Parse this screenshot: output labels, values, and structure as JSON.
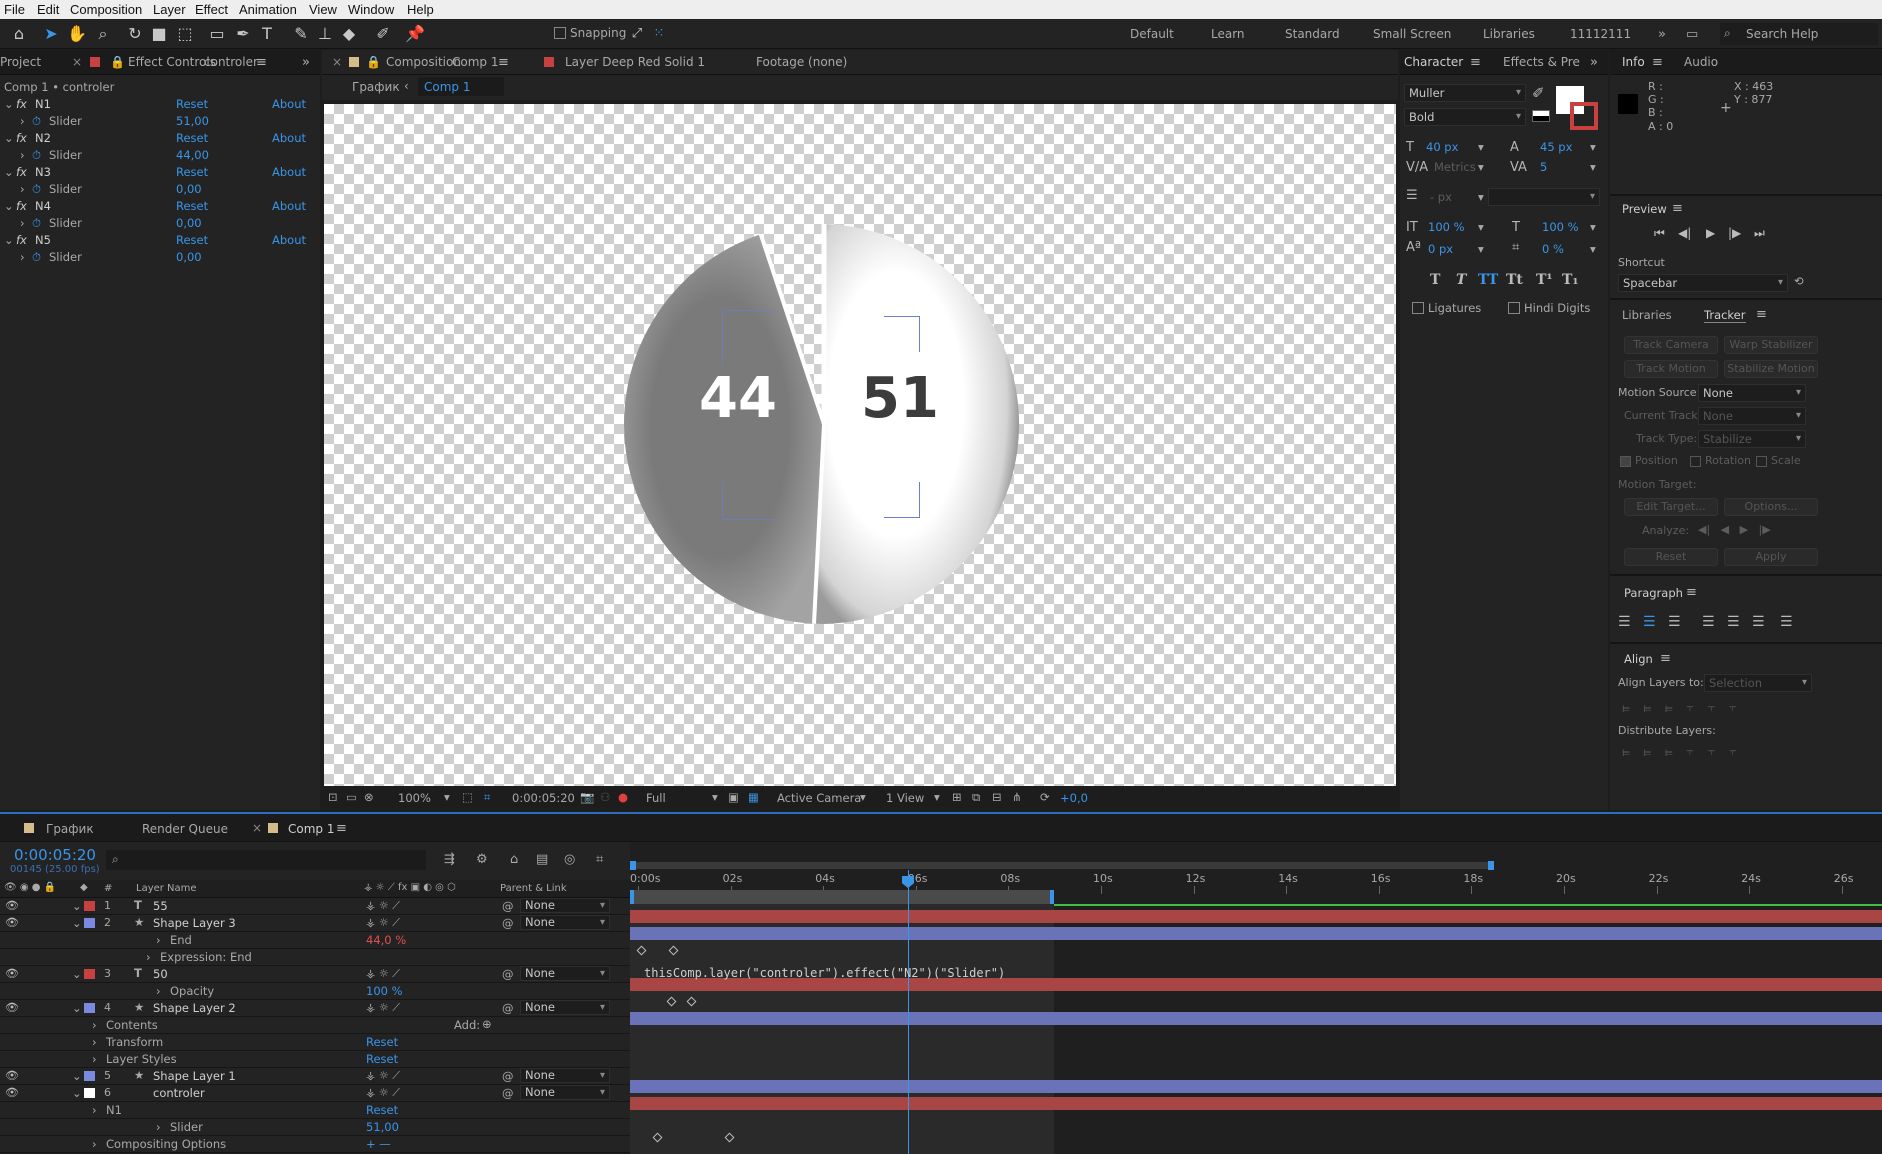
{
  "menu": [
    "File",
    "Edit",
    "Composition",
    "Layer",
    "Effect",
    "Animation",
    "View",
    "Window",
    "Help"
  ],
  "toolbar": {
    "snapping": "Snapping",
    "workspaces": [
      "Default",
      "Learn",
      "Standard",
      "Small Screen",
      "Libraries"
    ],
    "active_workspace": "11112111",
    "search": "Search Help"
  },
  "left_panel": {
    "tab_project": "Project",
    "tab_effect": "Effect Controls",
    "tab_effect_layer": "controler",
    "breadcrumb": "Comp 1 • controler",
    "effects": [
      {
        "name": "N1",
        "reset": "Reset",
        "about": "About",
        "param": "Slider",
        "value": "51,00"
      },
      {
        "name": "N2",
        "reset": "Reset",
        "about": "About",
        "param": "Slider",
        "value": "44,00"
      },
      {
        "name": "N3",
        "reset": "Reset",
        "about": "About",
        "param": "Slider",
        "value": "0,00"
      },
      {
        "name": "N4",
        "reset": "Reset",
        "about": "About",
        "param": "Slider",
        "value": "0,00"
      },
      {
        "name": "N5",
        "reset": "Reset",
        "about": "About",
        "param": "Slider",
        "value": "0,00"
      }
    ]
  },
  "viewer": {
    "tab_comp_prefix": "Composition",
    "tab_comp_name": "Comp 1",
    "tab_layer": "Layer  Deep Red Solid 1",
    "tab_footage": "Footage (none)",
    "crumb_root": "График",
    "crumb_comp": "Comp 1",
    "num_left": "44",
    "num_right": "51",
    "zoom": "100%",
    "timecode": "0:00:05:20",
    "resolution": "Full",
    "camera": "Active Camera",
    "views": "1 View",
    "exposure": "+0,0"
  },
  "character": {
    "tab": "Character",
    "tab2": "Effects & Pre",
    "font": "Muller",
    "style": "Bold",
    "size": "40 px",
    "leading": "45 px",
    "kerning": "Metrics",
    "tracking": "5",
    "stroke": "- px",
    "vscale": "100 %",
    "hscale": "100 %",
    "baseline": "0 px",
    "tsume": "0 %",
    "ligatures": "Ligatures",
    "hindi": "Hindi Digits",
    "styles": [
      "T",
      "T",
      "TT",
      "Tt",
      "T¹",
      "T₁"
    ]
  },
  "info": {
    "tab": "Info",
    "tab2": "Audio",
    "r": "R :",
    "g": "G :",
    "b": "B :",
    "a": "A : 0",
    "x": "X : 463",
    "y": "Y : 877"
  },
  "preview": {
    "title": "Preview",
    "shortcut_label": "Shortcut",
    "shortcut": "Spacebar"
  },
  "tracker": {
    "tab_lib": "Libraries",
    "tab": "Tracker",
    "track_camera": "Track Camera",
    "warp": "Warp Stabilizer",
    "track_motion": "Track Motion",
    "stabilize": "Stabilize Motion",
    "motion_source_label": "Motion Source:",
    "motion_source": "None",
    "current_track_label": "Current Track:",
    "current_track": "None",
    "track_type_label": "Track Type:",
    "track_type": "Stabilize",
    "position": "Position",
    "rotation": "Rotation",
    "scale": "Scale",
    "motion_target": "Motion Target:",
    "edit_target": "Edit Target...",
    "options": "Options...",
    "analyze": "Analyze:",
    "reset": "Reset",
    "apply": "Apply"
  },
  "paragraph": {
    "title": "Paragraph"
  },
  "align": {
    "title": "Align",
    "align_to_label": "Align Layers to:",
    "align_to": "Selection",
    "distribute": "Distribute Layers:"
  },
  "timeline": {
    "tab_graph": "График",
    "tab_render": "Render Queue",
    "tab_comp": "Comp 1",
    "timecode": "0:00:05:20",
    "fps": "00145 (25.00 fps)",
    "col_hash": "#",
    "col_name": "Layer Name",
    "col_parent": "Parent & Link",
    "ruler": [
      "0:00s",
      "02s",
      "04s",
      "06s",
      "08s",
      "10s",
      "12s",
      "14s",
      "16s",
      "18s",
      "20s",
      "22s",
      "24s",
      "26s"
    ],
    "layers": [
      {
        "idx": "1",
        "type": "T",
        "name": "55",
        "parent": "None",
        "color": "#c84141"
      },
      {
        "idx": "2",
        "type": "★",
        "name": "Shape Layer 3",
        "parent": "None",
        "color": "#7a8ae0"
      },
      {
        "sub": "End",
        "value": "44,0 %"
      },
      {
        "sub": "Expression: End"
      },
      {
        "idx": "3",
        "type": "T",
        "name": "50",
        "parent": "None",
        "color": "#c84141"
      },
      {
        "sub": "Opacity",
        "value": "100 %"
      },
      {
        "idx": "4",
        "type": "★",
        "name": "Shape Layer 2",
        "parent": "None",
        "color": "#7a8ae0"
      },
      {
        "sub": "Contents",
        "add": "Add:"
      },
      {
        "sub": "Transform",
        "reset": "Reset"
      },
      {
        "sub": "Layer Styles",
        "reset": "Reset"
      },
      {
        "idx": "5",
        "type": "★",
        "name": "Shape Layer 1",
        "parent": "None",
        "color": "#7a8ae0"
      },
      {
        "idx": "6",
        "type": "",
        "name": "controler",
        "parent": "None",
        "color": "#ffffff"
      },
      {
        "sub": "N1",
        "reset": "Reset"
      },
      {
        "sub": "Slider",
        "value": "51,00"
      },
      {
        "sub": "Compositing Options",
        "value": "+ —"
      }
    ],
    "expression": "thisComp.layer(\"controler\").effect(\"N2\")(\"Slider\")"
  }
}
